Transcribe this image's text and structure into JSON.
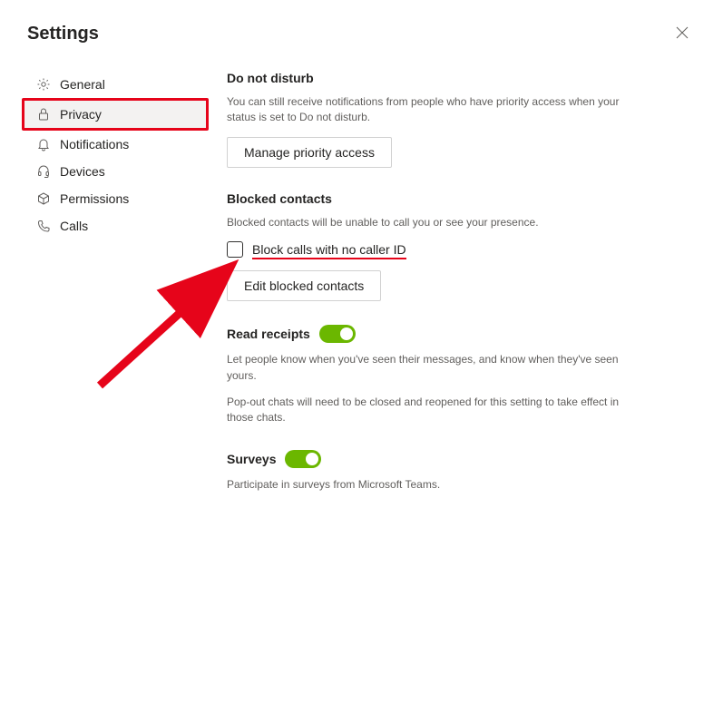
{
  "header": {
    "title": "Settings"
  },
  "sidebar": {
    "items": [
      {
        "label": "General"
      },
      {
        "label": "Privacy"
      },
      {
        "label": "Notifications"
      },
      {
        "label": "Devices"
      },
      {
        "label": "Permissions"
      },
      {
        "label": "Calls"
      }
    ]
  },
  "privacy": {
    "dnd": {
      "heading": "Do not disturb",
      "desc": "You can still receive notifications from people who have priority access when your status is set to Do not disturb.",
      "button": "Manage priority access"
    },
    "blocked": {
      "heading": "Blocked contacts",
      "desc": "Blocked contacts will be unable to call you or see your presence.",
      "checkbox_label": "Block calls with no caller ID",
      "checkbox_checked": false,
      "button": "Edit blocked contacts"
    },
    "read_receipts": {
      "heading": "Read receipts",
      "toggle_on": true,
      "desc1": "Let people know when you've seen their messages, and know when they've seen yours.",
      "desc2": "Pop-out chats will need to be closed and reopened for this setting to take effect in those chats."
    },
    "surveys": {
      "heading": "Surveys",
      "toggle_on": true,
      "desc": "Participate in surveys from Microsoft Teams."
    }
  },
  "annotations": {
    "highlight_target": "sidebar-item-privacy",
    "arrow_target": "block-calls-no-caller-id-checkbox",
    "color": "#e6041a"
  }
}
